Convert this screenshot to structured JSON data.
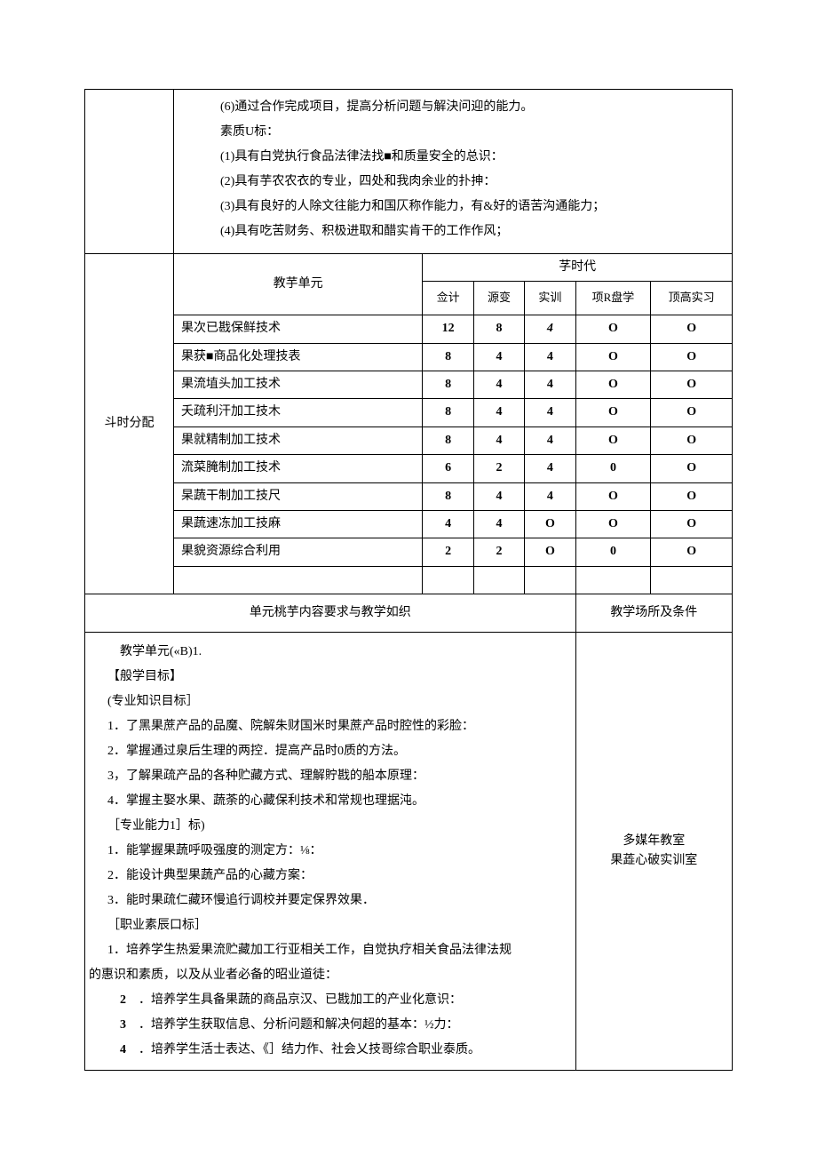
{
  "top_goals": {
    "line6": "(6)通过合作完成项目，提高分析问题与解決问迎的能力。",
    "quality_label": "素质U标：",
    "q1": "(1)具有白党执行食品法律法找■和质量安全的总识：",
    "q2": "(2)具有芋农农衣的专业，四处和我肉余业的扑抻：",
    "q3": "(3)具有良好的人除文往能力和国仄称作能力，有&好的语苦沟通能力；",
    "q4": "(4)具有吃苦财务、积极进取和醋实肯干的工作作风；"
  },
  "table_headers": {
    "label": "斗时分配",
    "unit_col": "教芋单元",
    "time_col": "芓时代",
    "sub1": "佥计",
    "sub2": "源变",
    "sub3": "实训",
    "sub4": "项R盘学",
    "sub5": "顶高实习"
  },
  "rows": [
    {
      "name": "果次已戡保鲜技术",
      "c1": "12",
      "c2": "8",
      "c3": "4",
      "c3_italic": true,
      "c4": "O",
      "c5": "O"
    },
    {
      "name": "果获■商品化处理技表",
      "c1": "8",
      "c2": "4",
      "c3": "4",
      "c4": "O",
      "c5": "O"
    },
    {
      "name": "果流埴头加工技术",
      "c1": "8",
      "c2": "4",
      "c3": "4",
      "c4": "O",
      "c5": "O"
    },
    {
      "name": "夭疏利汗加工技木",
      "c1": "8",
      "c2": "4",
      "c3": "4",
      "c4": "O",
      "c5": "O"
    },
    {
      "name": "果就精制加工技术",
      "c1": "8",
      "c2": "4",
      "c3": "4",
      "c4": "O",
      "c5": "O"
    },
    {
      "name": "流菜腌制加工技术",
      "c1": "6",
      "c2": "2",
      "c3": "4",
      "c4": "0",
      "c5": "O"
    },
    {
      "name": "杲蔬干制加工技尺",
      "c1": "8",
      "c2": "4",
      "c3": "4",
      "c4": "O",
      "c5": "O"
    },
    {
      "name": "果蔬速冻加工技麻",
      "c1": "4",
      "c2": "4",
      "c3": "O",
      "c4": "O",
      "c5": "O"
    },
    {
      "name": "果貌资源综合利用",
      "c1": "2",
      "c2": "2",
      "c3": "O",
      "c4": "0",
      "c5": "O"
    }
  ],
  "section": {
    "left_header": "单元桃芋内容要求与教学如织",
    "right_header": "教学场所及条件"
  },
  "detail": {
    "title": "教学单元(«B)1.",
    "goal_header": "【般学目标】",
    "know_header": "(专业知识目标］",
    "k1": "1．了黑果蔗产品的品魔、院解朱财国米时果蔗产品时腔性的彩脸：",
    "k2": "2．掌握通过泉后生理的两控．提高产品时0质的方法。",
    "k3": "3，了解果疏产品的各种贮藏方式、理解貯戡的船本原理：",
    "k4": "4．掌握主娶水果、蔬荼的心藏保利技术和常规也理据沌。",
    "ability_header": "［专业能力1］标)",
    "a1": "1．能掌握果蔬呼吸强度的测定方：⅛：",
    "a2": "2．能设计典型果蔬产品的心藏方案：",
    "a3": "3．能时果疏仁藏环慢追行调校并要定保界效果．",
    "occ_header": "［职业素辰口标］",
    "o1": "1．培养学生热爱果流贮藏加工行亚相关工作，自觉执疗相关食品法律法规",
    "o1b": "的惠识和素质，以及从业者必备的昭业道徒：",
    "o2": "．培养学生具备果蔬的商品京汉、已戡加工的产业化意识：",
    "o2n": "2",
    "o3": "．培养学生获取信息、分析问题和解决何超的基本：½力：",
    "o3n": "3",
    "o4": "．培养学生活士表达、《］结力作、社会乂技哥综合职业泰质。",
    "o4n": "4"
  },
  "venue": {
    "line1": "多媒年教室",
    "line2": "果蕋心破实训室"
  }
}
